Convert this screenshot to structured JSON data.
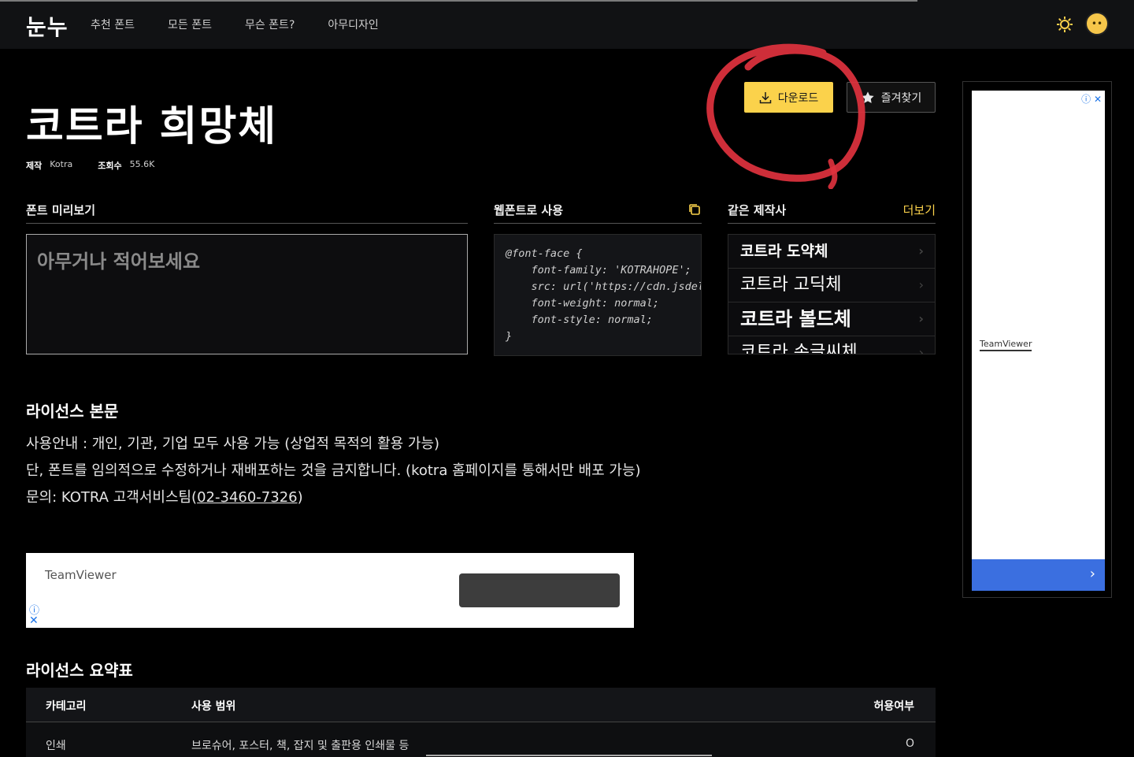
{
  "nav": {
    "logo": "눈누",
    "links": [
      "추천 폰트",
      "모든 폰트",
      "무슨 폰트?",
      "아무디자인"
    ]
  },
  "font": {
    "title": "코트라 희망체",
    "maker_label": "제작",
    "maker": "Kotra",
    "views_label": "조회수",
    "views": "55.6K"
  },
  "actions": {
    "download": "다운로드",
    "favorite": "즐겨찾기"
  },
  "preview": {
    "header": "폰트 미리보기",
    "placeholder": "아무거나 적어보세요"
  },
  "webfont": {
    "header": "웹폰트로 사용",
    "code": "@font-face {\n    font-family: 'KOTRAHOPE';\n    src: url('https://cdn.jsdelivr.net/gh/projectnoonnu/noonfonts_20-10-21@1.0/KOTRAHOPE.woff') format('woff');\n    font-weight: normal;\n    font-style: normal;\n}"
  },
  "same_maker": {
    "header": "같은 제작사",
    "more": "더보기",
    "items": [
      "코트라 도약체",
      "코트라 고딕체",
      "코트라 볼드체",
      "코트라 손글씨체"
    ]
  },
  "license": {
    "title": "라이선스 본문",
    "line1": "사용안내 : 개인, 기관, 기업 모두 사용 가능 (상업적 목적의 활용 가능)",
    "line2": "단, 폰트를 임의적으로 수정하거나 재배포하는 것을 금지합니다. (kotra 홈페이지를 통해서만 배포 가능)",
    "line3_prefix": "문의: KOTRA 고객서비스팀(",
    "line3_phone": "02-3460-7326",
    "line3_suffix": ")"
  },
  "ads": {
    "bottom_brand": "TeamViewer",
    "side_brand": "TeamViewer"
  },
  "summary": {
    "title": "라이선스 요약표",
    "headers": [
      "카테고리",
      "사용 범위",
      "허용여부"
    ],
    "rows": [
      {
        "category": "인쇄",
        "scope": "브로슈어, 포스터, 책, 잡지 및 출판용 인쇄물 등",
        "allowed": "O"
      }
    ]
  },
  "colors": {
    "accent": "#fbd24b",
    "background": "#000000",
    "annotation": "#e0323e"
  }
}
